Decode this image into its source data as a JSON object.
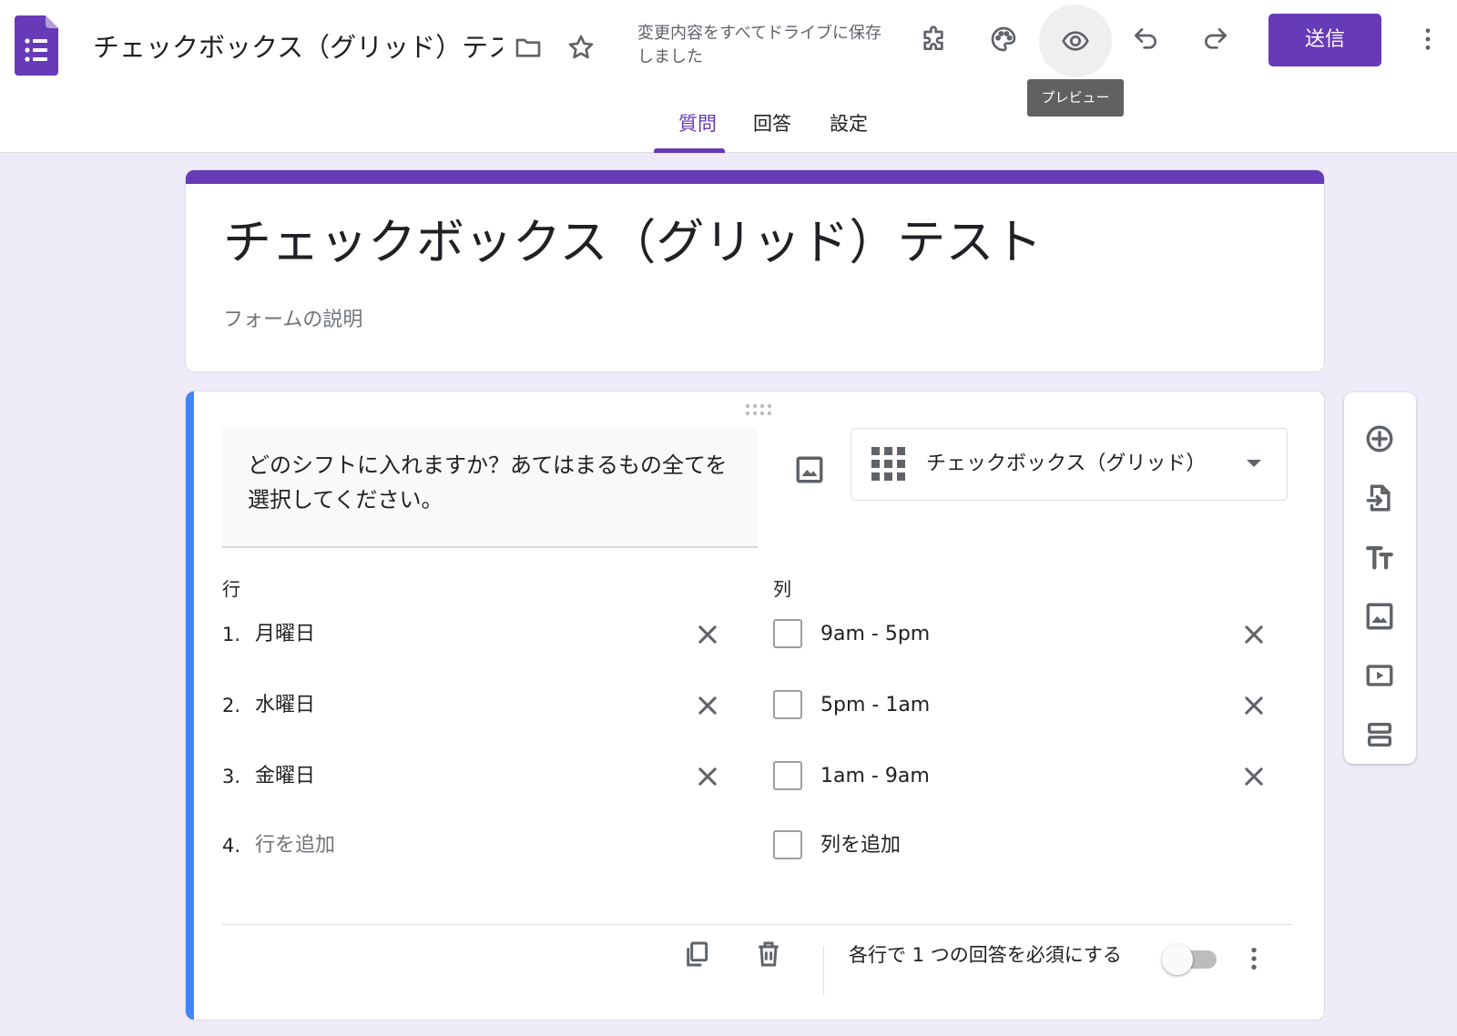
{
  "header": {
    "doc_title": "チェックボックス（グリッド）テスト",
    "save_status": "変更内容をすべてドライブに保存しました",
    "send_label": "送信",
    "tooltip": "プレビュー",
    "tabs": [
      {
        "label": "質問",
        "active": true
      },
      {
        "label": "回答",
        "active": false
      },
      {
        "label": "設定",
        "active": false
      }
    ],
    "icons": [
      "forms-logo-icon",
      "folder-icon",
      "star-icon",
      "addon-icon",
      "palette-icon",
      "preview-eye-icon",
      "undo-icon",
      "redo-icon",
      "more-vert-icon"
    ]
  },
  "form": {
    "title": "チェックボックス（グリッド）テスト",
    "description_placeholder": "フォームの説明"
  },
  "question": {
    "text": "どのシフトに入れますか？あてはまるもの全てを選択してください。",
    "type_label": "チェックボックス（グリッド）",
    "rows_label": "行",
    "columns_label": "列",
    "rows": [
      {
        "num": "1.",
        "label": "月曜日"
      },
      {
        "num": "2.",
        "label": "水曜日"
      },
      {
        "num": "3.",
        "label": "金曜日"
      }
    ],
    "add_row": {
      "num": "4.",
      "label": "行を追加"
    },
    "columns": [
      {
        "label": "9am - 5pm"
      },
      {
        "label": "5pm - 1am"
      },
      {
        "label": "1am - 9am"
      }
    ],
    "add_column": {
      "label": "列を追加"
    },
    "required_label": "各行で 1 つの回答を必須にする",
    "required_on": false
  },
  "side_toolbar": {
    "icons": [
      "add-question-icon",
      "import-questions-icon",
      "add-title-icon",
      "add-image-icon",
      "add-video-icon",
      "add-section-icon"
    ]
  },
  "colors": {
    "primary": "#673ab7",
    "accent_bar": "#4285f4",
    "background": "#f0ebf8"
  }
}
